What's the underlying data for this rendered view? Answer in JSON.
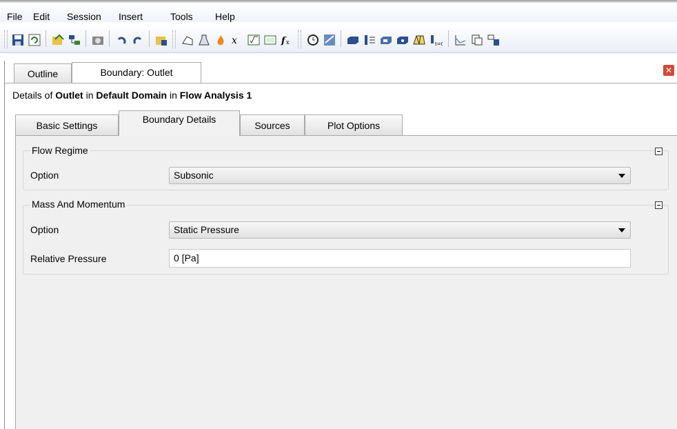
{
  "menu": [
    "File",
    "Edit",
    "Session",
    "Insert",
    "Tools",
    "Help"
  ],
  "toolbar": {
    "icons": [
      "save-icon",
      "refresh-icon",
      "export-icon",
      "network-icon",
      "camera-icon",
      "undo-icon",
      "redo-icon",
      "import-icon",
      "domain-icon",
      "material-icon",
      "reaction-icon",
      "expression-icon",
      "function-icon",
      "subroutine-icon",
      "fx-icon",
      "clock-icon",
      "solver-icon",
      "boundary-icon",
      "interface-icon",
      "subdomain-icon",
      "source-icon",
      "mesh-icon",
      "timestep-icon",
      "chart-icon",
      "monitor-icon",
      "output-icon"
    ]
  },
  "tabs": [
    {
      "label": "Outline",
      "active": false
    },
    {
      "label": "Boundary: Outlet",
      "active": true
    }
  ],
  "details": {
    "prefix": "Details of ",
    "object": "Outlet",
    "in1": " in ",
    "domain": "Default Domain",
    "in2": " in ",
    "analysis": "Flow Analysis 1"
  },
  "subtabs": [
    {
      "label": "Basic Settings",
      "active": false
    },
    {
      "label": "Boundary Details",
      "active": true
    },
    {
      "label": "Sources",
      "active": false
    },
    {
      "label": "Plot Options",
      "active": false
    }
  ],
  "flow_regime": {
    "title": "Flow Regime",
    "option_label": "Option",
    "option_value": "Subsonic"
  },
  "mass_momentum": {
    "title": "Mass And Momentum",
    "option_label": "Option",
    "option_value": "Static Pressure",
    "pressure_label": "Relative Pressure",
    "pressure_value": "0 [Pa]"
  },
  "colors": {
    "close_button": "#d24a3b",
    "panel_bg": "#f0f0f0"
  }
}
